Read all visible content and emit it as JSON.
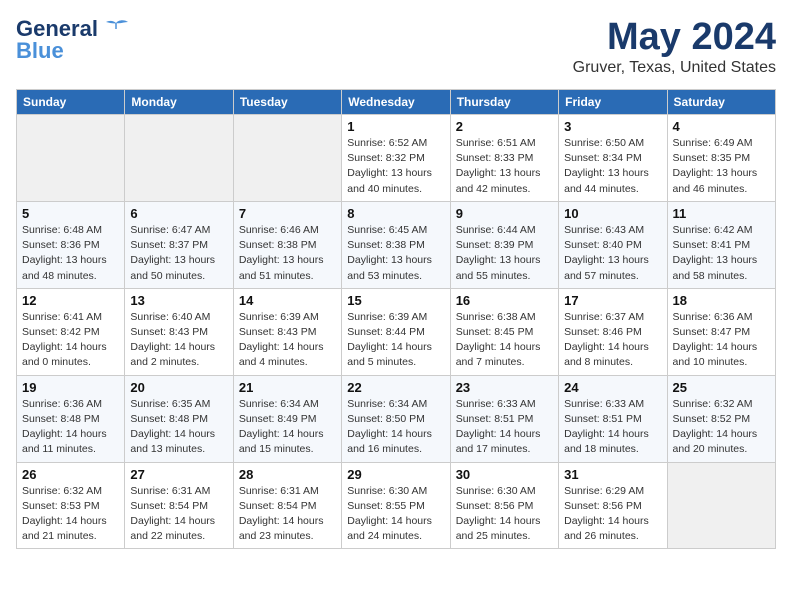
{
  "logo": {
    "line1": "General",
    "line2": "Blue"
  },
  "header": {
    "title": "May 2024",
    "subtitle": "Gruver, Texas, United States"
  },
  "weekdays": [
    "Sunday",
    "Monday",
    "Tuesday",
    "Wednesday",
    "Thursday",
    "Friday",
    "Saturday"
  ],
  "weeks": [
    [
      {
        "day": "",
        "sunrise": "",
        "sunset": "",
        "daylight": ""
      },
      {
        "day": "",
        "sunrise": "",
        "sunset": "",
        "daylight": ""
      },
      {
        "day": "",
        "sunrise": "",
        "sunset": "",
        "daylight": ""
      },
      {
        "day": "1",
        "sunrise": "Sunrise: 6:52 AM",
        "sunset": "Sunset: 8:32 PM",
        "daylight": "Daylight: 13 hours and 40 minutes."
      },
      {
        "day": "2",
        "sunrise": "Sunrise: 6:51 AM",
        "sunset": "Sunset: 8:33 PM",
        "daylight": "Daylight: 13 hours and 42 minutes."
      },
      {
        "day": "3",
        "sunrise": "Sunrise: 6:50 AM",
        "sunset": "Sunset: 8:34 PM",
        "daylight": "Daylight: 13 hours and 44 minutes."
      },
      {
        "day": "4",
        "sunrise": "Sunrise: 6:49 AM",
        "sunset": "Sunset: 8:35 PM",
        "daylight": "Daylight: 13 hours and 46 minutes."
      }
    ],
    [
      {
        "day": "5",
        "sunrise": "Sunrise: 6:48 AM",
        "sunset": "Sunset: 8:36 PM",
        "daylight": "Daylight: 13 hours and 48 minutes."
      },
      {
        "day": "6",
        "sunrise": "Sunrise: 6:47 AM",
        "sunset": "Sunset: 8:37 PM",
        "daylight": "Daylight: 13 hours and 50 minutes."
      },
      {
        "day": "7",
        "sunrise": "Sunrise: 6:46 AM",
        "sunset": "Sunset: 8:38 PM",
        "daylight": "Daylight: 13 hours and 51 minutes."
      },
      {
        "day": "8",
        "sunrise": "Sunrise: 6:45 AM",
        "sunset": "Sunset: 8:38 PM",
        "daylight": "Daylight: 13 hours and 53 minutes."
      },
      {
        "day": "9",
        "sunrise": "Sunrise: 6:44 AM",
        "sunset": "Sunset: 8:39 PM",
        "daylight": "Daylight: 13 hours and 55 minutes."
      },
      {
        "day": "10",
        "sunrise": "Sunrise: 6:43 AM",
        "sunset": "Sunset: 8:40 PM",
        "daylight": "Daylight: 13 hours and 57 minutes."
      },
      {
        "day": "11",
        "sunrise": "Sunrise: 6:42 AM",
        "sunset": "Sunset: 8:41 PM",
        "daylight": "Daylight: 13 hours and 58 minutes."
      }
    ],
    [
      {
        "day": "12",
        "sunrise": "Sunrise: 6:41 AM",
        "sunset": "Sunset: 8:42 PM",
        "daylight": "Daylight: 14 hours and 0 minutes."
      },
      {
        "day": "13",
        "sunrise": "Sunrise: 6:40 AM",
        "sunset": "Sunset: 8:43 PM",
        "daylight": "Daylight: 14 hours and 2 minutes."
      },
      {
        "day": "14",
        "sunrise": "Sunrise: 6:39 AM",
        "sunset": "Sunset: 8:43 PM",
        "daylight": "Daylight: 14 hours and 4 minutes."
      },
      {
        "day": "15",
        "sunrise": "Sunrise: 6:39 AM",
        "sunset": "Sunset: 8:44 PM",
        "daylight": "Daylight: 14 hours and 5 minutes."
      },
      {
        "day": "16",
        "sunrise": "Sunrise: 6:38 AM",
        "sunset": "Sunset: 8:45 PM",
        "daylight": "Daylight: 14 hours and 7 minutes."
      },
      {
        "day": "17",
        "sunrise": "Sunrise: 6:37 AM",
        "sunset": "Sunset: 8:46 PM",
        "daylight": "Daylight: 14 hours and 8 minutes."
      },
      {
        "day": "18",
        "sunrise": "Sunrise: 6:36 AM",
        "sunset": "Sunset: 8:47 PM",
        "daylight": "Daylight: 14 hours and 10 minutes."
      }
    ],
    [
      {
        "day": "19",
        "sunrise": "Sunrise: 6:36 AM",
        "sunset": "Sunset: 8:48 PM",
        "daylight": "Daylight: 14 hours and 11 minutes."
      },
      {
        "day": "20",
        "sunrise": "Sunrise: 6:35 AM",
        "sunset": "Sunset: 8:48 PM",
        "daylight": "Daylight: 14 hours and 13 minutes."
      },
      {
        "day": "21",
        "sunrise": "Sunrise: 6:34 AM",
        "sunset": "Sunset: 8:49 PM",
        "daylight": "Daylight: 14 hours and 15 minutes."
      },
      {
        "day": "22",
        "sunrise": "Sunrise: 6:34 AM",
        "sunset": "Sunset: 8:50 PM",
        "daylight": "Daylight: 14 hours and 16 minutes."
      },
      {
        "day": "23",
        "sunrise": "Sunrise: 6:33 AM",
        "sunset": "Sunset: 8:51 PM",
        "daylight": "Daylight: 14 hours and 17 minutes."
      },
      {
        "day": "24",
        "sunrise": "Sunrise: 6:33 AM",
        "sunset": "Sunset: 8:51 PM",
        "daylight": "Daylight: 14 hours and 18 minutes."
      },
      {
        "day": "25",
        "sunrise": "Sunrise: 6:32 AM",
        "sunset": "Sunset: 8:52 PM",
        "daylight": "Daylight: 14 hours and 20 minutes."
      }
    ],
    [
      {
        "day": "26",
        "sunrise": "Sunrise: 6:32 AM",
        "sunset": "Sunset: 8:53 PM",
        "daylight": "Daylight: 14 hours and 21 minutes."
      },
      {
        "day": "27",
        "sunrise": "Sunrise: 6:31 AM",
        "sunset": "Sunset: 8:54 PM",
        "daylight": "Daylight: 14 hours and 22 minutes."
      },
      {
        "day": "28",
        "sunrise": "Sunrise: 6:31 AM",
        "sunset": "Sunset: 8:54 PM",
        "daylight": "Daylight: 14 hours and 23 minutes."
      },
      {
        "day": "29",
        "sunrise": "Sunrise: 6:30 AM",
        "sunset": "Sunset: 8:55 PM",
        "daylight": "Daylight: 14 hours and 24 minutes."
      },
      {
        "day": "30",
        "sunrise": "Sunrise: 6:30 AM",
        "sunset": "Sunset: 8:56 PM",
        "daylight": "Daylight: 14 hours and 25 minutes."
      },
      {
        "day": "31",
        "sunrise": "Sunrise: 6:29 AM",
        "sunset": "Sunset: 8:56 PM",
        "daylight": "Daylight: 14 hours and 26 minutes."
      },
      {
        "day": "",
        "sunrise": "",
        "sunset": "",
        "daylight": ""
      }
    ]
  ]
}
